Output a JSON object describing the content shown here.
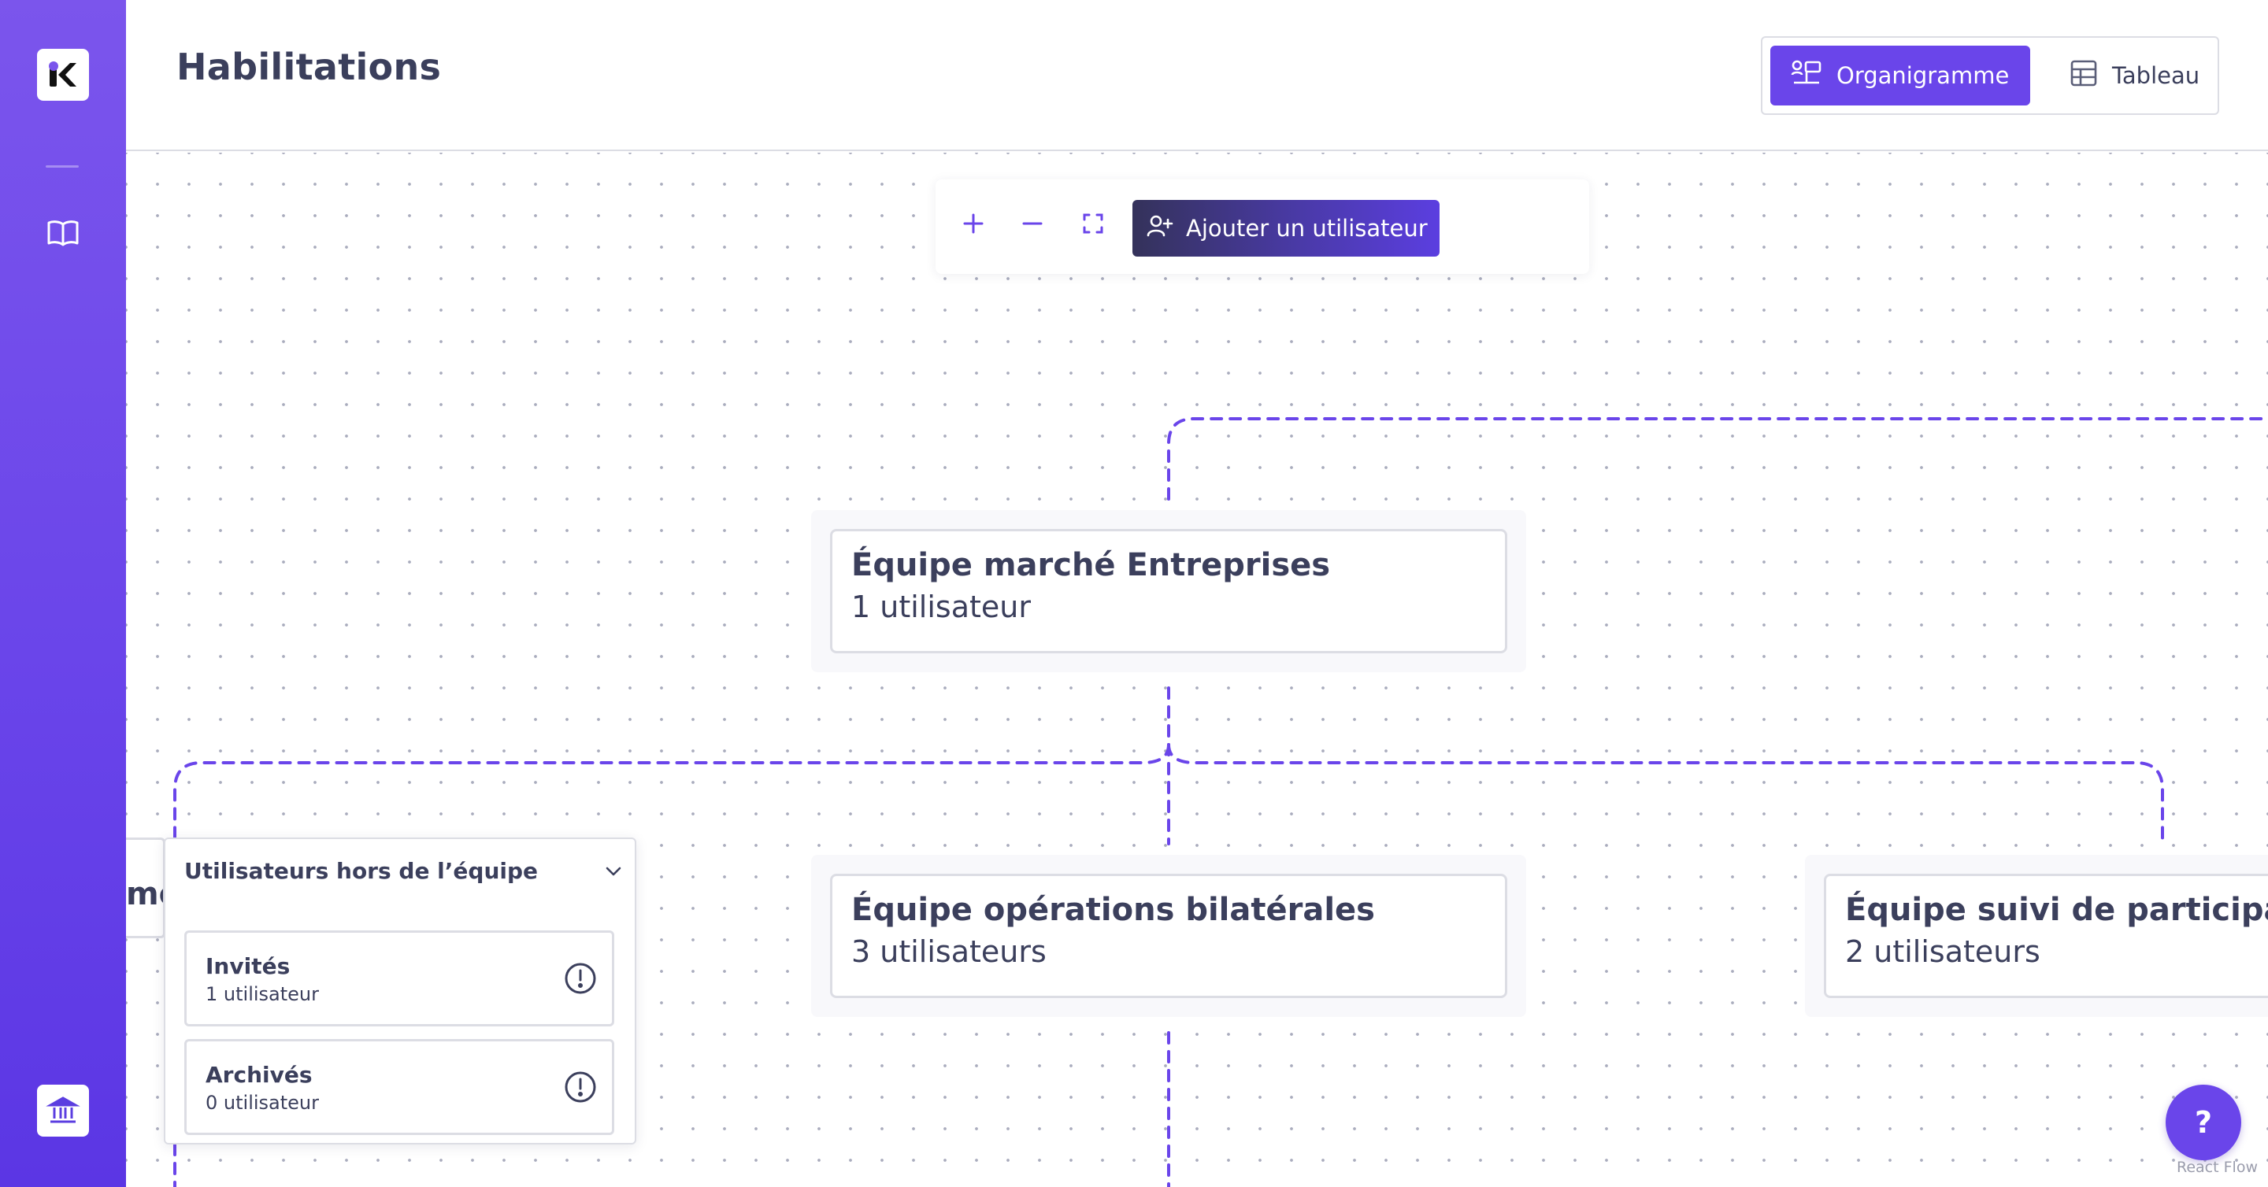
{
  "app": {
    "title": "Habilitations"
  },
  "view_toggle": {
    "organigram_label": "Organigramme",
    "table_label": "Tableau",
    "active": "Organigramme"
  },
  "toolbar": {
    "add_user_label": "Ajouter un utilisateur"
  },
  "teams": [
    {
      "name": "Équipe marché Entreprises",
      "count": "1 utilisateur"
    },
    {
      "name": "Équipe opérations bilatérales",
      "count": "3 utilisateurs"
    },
    {
      "name": "Équipe suivi de participat",
      "count": "2 utilisateurs"
    }
  ],
  "partial_left_label": "me",
  "out_of_team": {
    "title": "Utilisateurs hors de l’équipe",
    "cards": [
      {
        "name": "Invités",
        "count": "1 utilisateur"
      },
      {
        "name": "Archivés",
        "count": "0 utilisateur"
      }
    ]
  },
  "help": {
    "label": "?"
  },
  "attribution": "React Flow",
  "colors": {
    "accent": "#6a45ea",
    "text": "#3b3f5c",
    "border": "#dcdde4",
    "edge": "#6a45ea"
  },
  "icons": [
    "logo-icon",
    "book-icon",
    "bank-icon",
    "org-chart-icon",
    "table-icon",
    "plus-icon",
    "minus-icon",
    "fit-view-icon",
    "add-user-icon",
    "chevron-down-icon",
    "alert-circle-icon"
  ]
}
